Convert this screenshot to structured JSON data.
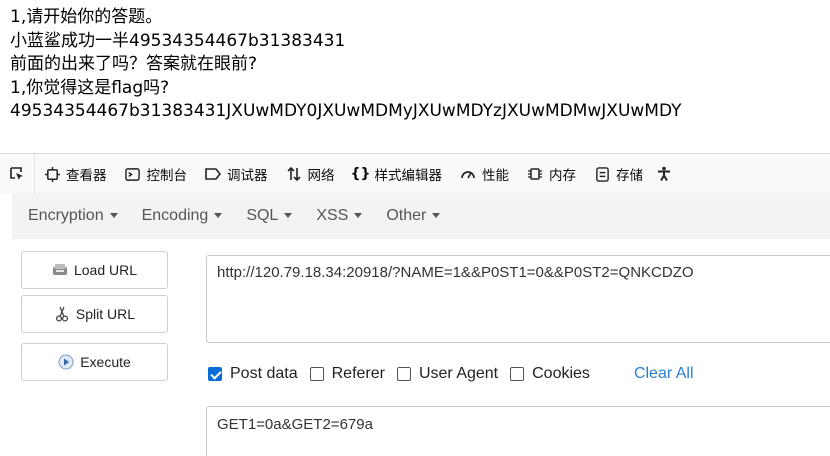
{
  "page": {
    "lines": [
      "1,请开始你的答题。",
      "小蓝鲨成功一半49534354467b31383431",
      "前面的出来了吗？答案就在眼前?",
      "1,你觉得这是flag吗?",
      "49534354467b31383431JXUwMDY0JXUwMDMyJXUwMDYzJXUwMDMwJXUwMDY"
    ]
  },
  "devtools": {
    "tabs": [
      {
        "label": "查看器",
        "icon": "inspector-icon"
      },
      {
        "label": "控制台",
        "icon": "console-icon"
      },
      {
        "label": "调试器",
        "icon": "debugger-icon"
      },
      {
        "label": "网络",
        "icon": "network-icon"
      },
      {
        "label": "样式编辑器",
        "icon": "style-editor-icon"
      },
      {
        "label": "性能",
        "icon": "performance-icon"
      },
      {
        "label": "内存",
        "icon": "memory-icon"
      },
      {
        "label": "存储",
        "icon": "storage-icon"
      }
    ]
  },
  "hackbar": {
    "menu": [
      "Encryption",
      "Encoding",
      "SQL",
      "XSS",
      "Other"
    ],
    "buttons": {
      "load": "Load URL",
      "split": "Split URL",
      "execute": "Execute"
    },
    "url": "http://120.79.18.34:20918/?NAME=1&&P0ST1=0&&P0ST2=QNKCDZO",
    "options": {
      "post_data": {
        "label": "Post data",
        "checked": true
      },
      "referer": {
        "label": "Referer",
        "checked": false
      },
      "user_agent": {
        "label": "User Agent",
        "checked": false
      },
      "cookies": {
        "label": "Cookies",
        "checked": false
      }
    },
    "clear_all": "Clear All",
    "post_body": "GET1=0a&GET2=679a"
  },
  "colors": {
    "accent": "#0a6cd6",
    "link": "#2a7fd4",
    "toolbar_bg": "#f9f9fa",
    "hackbar_bg": "#f3f3f3"
  }
}
